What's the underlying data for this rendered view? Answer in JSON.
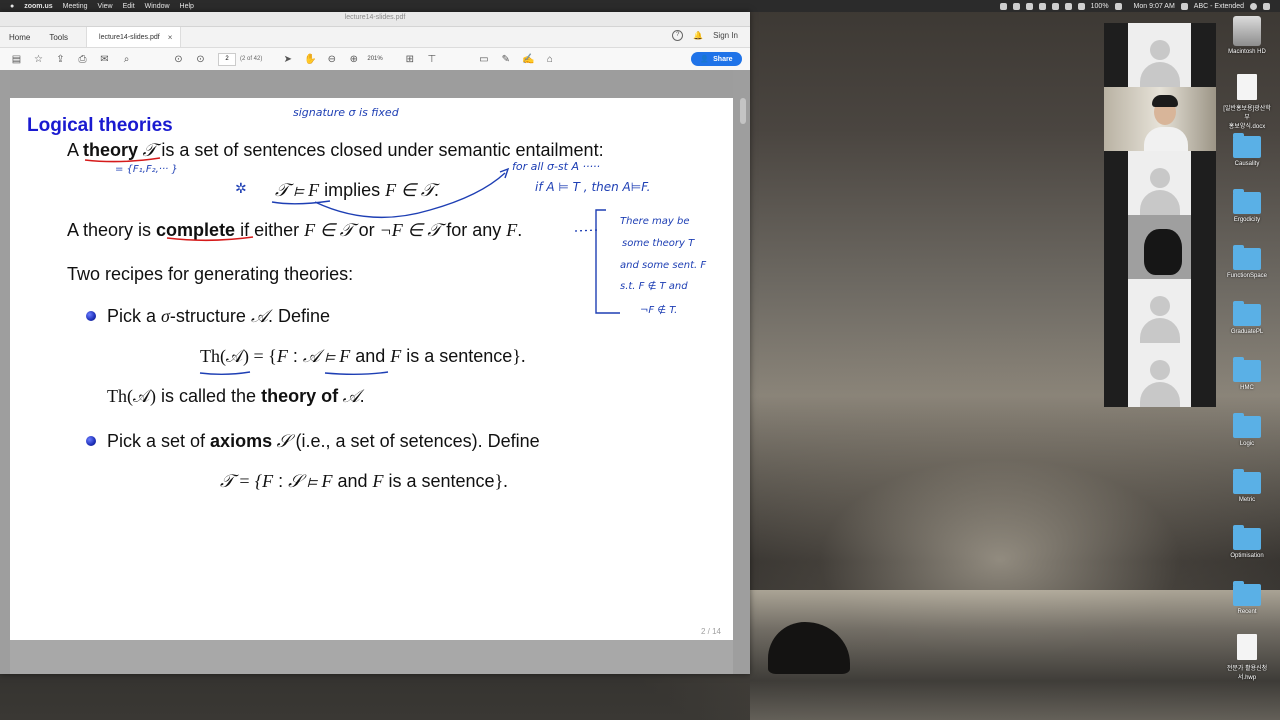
{
  "menubar": {
    "app": "zoom.us",
    "items": [
      "Meeting",
      "View",
      "Edit",
      "Window",
      "Help"
    ],
    "battery": "100%",
    "clock": "Mon 9:07 AM",
    "input_source": "ABC - Extended"
  },
  "acrobat": {
    "window_title": "lecture14-slides.pdf",
    "nav_home": "Home",
    "nav_tools": "Tools",
    "tab_label": "lecture14-slides.pdf",
    "tab_close": "×",
    "sign_in": "Sign In",
    "page_input": "2",
    "page_of": "(2 of 42)",
    "zoom": "201%",
    "share_label": "Share"
  },
  "slide": {
    "title": "Logical theories",
    "page_number": "2 / 14",
    "line1": {
      "pre": "A ",
      "bold": "theory",
      "mid": " 𝒯",
      "post": " is a set of sentences closed under semantic entailment:"
    },
    "line2": {
      "formula": "𝒯 ⊨ F",
      "text": " implies ",
      "formula2": "F ∈ 𝒯."
    },
    "line3": {
      "pre": "A theory is ",
      "bold": "complete",
      "post1": " if either ",
      "f1": "F ∈ 𝒯",
      "or": " or ",
      "f2": "¬F ∈ 𝒯",
      "post2": " for any ",
      "f3": "F",
      "end": "."
    },
    "line4": "Two recipes for generating theories:",
    "bullet1": {
      "pre": "Pick a ",
      "sigma": "σ",
      "mid": "-structure ",
      "A": "𝒜",
      "post": ". Define"
    },
    "formula1": {
      "lhs": "Th(𝒜) = {",
      "F": "F",
      "colon": " : ",
      "cond": "𝒜 ⊨ F",
      "and": " and ",
      "F2": "F",
      "tail": " is a sentence",
      "close": "}."
    },
    "called": {
      "pre": "Th(𝒜)",
      "mid": " is called the ",
      "bold": "theory of",
      "A": " 𝒜",
      "end": "."
    },
    "bullet2": {
      "pre": "Pick a set of ",
      "bold": "axioms",
      "S": " 𝒮",
      "post": " (i.e., a set of setences). Define"
    },
    "formula2": {
      "lhs": "𝒯 = {",
      "F": "F",
      "colon": " : ",
      "cond": "𝒮 ⊨ F",
      "and": " and ",
      "F2": "F",
      "tail": " is a sentence",
      "close": "}."
    }
  },
  "handwriting": {
    "top": "signature σ is fixed",
    "under_theory": "= {F₁,F₂,··· }",
    "left_mark": "✲",
    "right1": "for all σ-st  A ·····",
    "right2": "if  A ⊨ T , then A⊨F.",
    "note1": "There may be",
    "note2": "some theory T",
    "note3": "and some sent. F",
    "note4": "s.t.  F ∉ T and",
    "note5": "¬F ∉ T."
  },
  "desktop_icons": [
    {
      "label": "Macintosh HD",
      "kind": "drive"
    },
    {
      "label": "[일반홍보용]광산학부\n홍보양식.docx",
      "kind": "doc"
    },
    {
      "label": "Causality",
      "kind": "folder"
    },
    {
      "label": "Ergodicity",
      "kind": "folder"
    },
    {
      "label": "FunctionSpace",
      "kind": "folder"
    },
    {
      "label": "GraduatePL",
      "kind": "folder"
    },
    {
      "label": "HMC",
      "kind": "folder"
    },
    {
      "label": "Logic",
      "kind": "folder"
    },
    {
      "label": "Metric",
      "kind": "folder"
    },
    {
      "label": "Optimisation",
      "kind": "folder"
    },
    {
      "label": "Recent",
      "kind": "folder"
    },
    {
      "label": "전문가 활용신청\n서.hwp",
      "kind": "doc"
    }
  ]
}
